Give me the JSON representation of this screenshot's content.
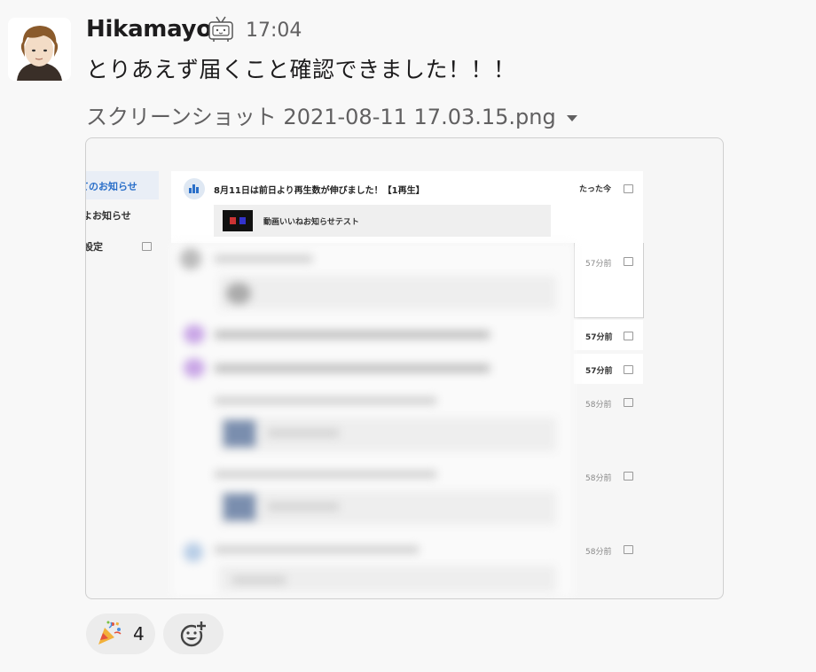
{
  "message": {
    "author": "Hikamayo",
    "time": "17:04",
    "text": "とりあえず届くこと確認できました！！！",
    "bot_badge_icon": "tv-bot-icon"
  },
  "attachment": {
    "filename": "スクリーンショット 2021-08-11 17.03.15.png",
    "menu_icon": "chevron-down-icon",
    "screenshot": {
      "sidebar_items": [
        "てのお知らせ",
        "よお知らせ",
        "設定"
      ],
      "top_notification": {
        "title": "8月11日は前日より再生数が伸びました！【1再生】",
        "time": "たった今",
        "subitem": "動画いいねお知らせテスト"
      },
      "times": [
        "57分前",
        "57分前",
        "57分前",
        "58分前",
        "58分前",
        "58分前"
      ]
    }
  },
  "reactions": [
    {
      "emoji": "party-popper-icon",
      "count": "4"
    }
  ],
  "add_reaction_icon": "add-reaction-icon",
  "colors": {
    "accent": "#2a6fc9",
    "background": "#f8f8f8"
  }
}
